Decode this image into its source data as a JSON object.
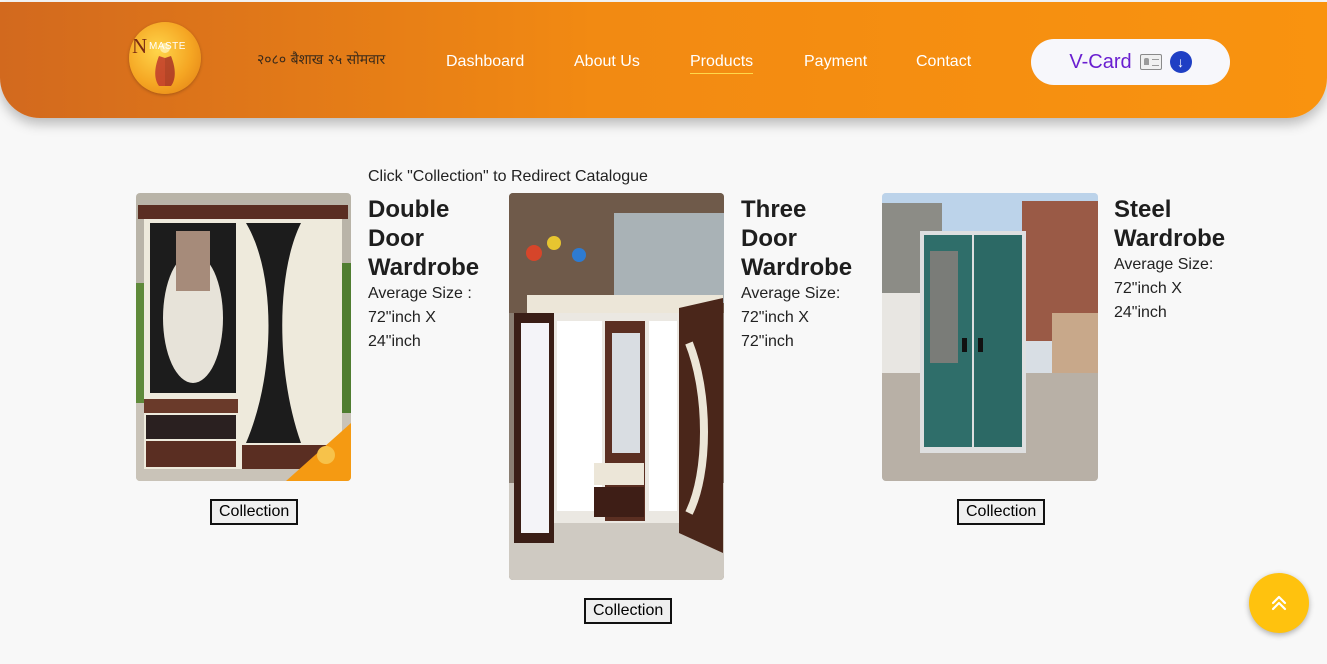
{
  "header": {
    "logo_text": "N",
    "logo_small": "MASTE",
    "date": "२०८० बैशाख २५ सोमवार",
    "nav": [
      {
        "label": "Dashboard"
      },
      {
        "label": "About Us"
      },
      {
        "label": "Products"
      },
      {
        "label": "Payment"
      },
      {
        "label": "Contact"
      }
    ],
    "active_nav": "Products",
    "vcard_label": "V-Card",
    "accent_color": "#f9930f"
  },
  "main": {
    "hint": "Click \"Collection\" to Redirect Catalogue",
    "products": [
      {
        "title_lines": [
          "Double",
          "Door",
          "Wardrobe"
        ],
        "desc_lines": [
          "Average Size :",
          "72\"inch X",
          "24\"inch"
        ],
        "button_label": "Collection"
      },
      {
        "title_lines": [
          "Three",
          "Door",
          "Wardrobe"
        ],
        "desc_lines": [
          "Average Size:",
          "72\"inch X",
          "72\"inch"
        ],
        "button_label": "Collection"
      },
      {
        "title_lines": [
          "Steel",
          "Wardrobe"
        ],
        "desc_lines": [
          "Average Size:",
          "72\"inch X",
          "24\"inch"
        ],
        "button_label": "Collection"
      }
    ]
  },
  "scroll_top_icon": "double-chevron-up-icon"
}
